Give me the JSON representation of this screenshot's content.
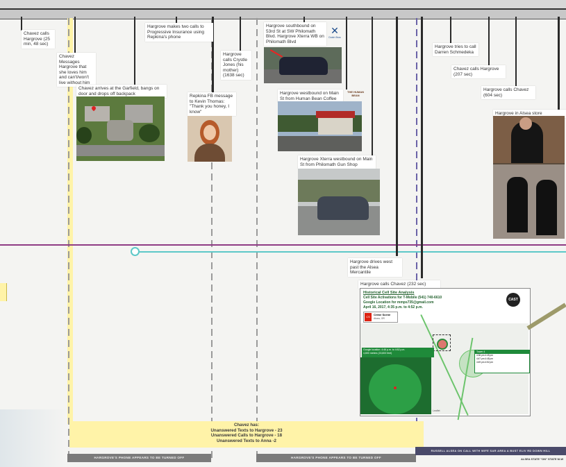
{
  "events": {
    "e1": "Chavez calls Hargrove (25 min, 48 sec)",
    "e2": "Chavez Messages Hargrove that she loves him and can't/won't live without him",
    "e3": "Chavez arrives at the Garfield, bangs on door and drops off backpack",
    "e4": "Hargrove makes two calls to Progressive Insurance using Repkina's phone",
    "e5": "Repkina FB message to Kevin Thomas: \"Thank you honey, I know\"",
    "e6": "Hargrove calls Crystle Jones (his mother) (1638 sec)",
    "e7": "Hargrove southbound on 53rd St at SW Philomath Blvd. Hargrove Xterra WB on Philomath Blvd",
    "e8": "Hargrove westbound on Main St from Human Bean Coffee",
    "e9": "Hargrove Xterra westbound on Main St from Philomath Gun Shop",
    "e10": "Hargrove drives west past the Alsea Mercantile",
    "e11": "Hargrove calls Chavez (232 sec)",
    "e12": "Hargrove tries to call Darren Schmedeka",
    "e13": "Chavez calls Hargrove (207 sec)",
    "e14": "Hargrove calls Chavez (604 sec)",
    "e15": "Hargrove in Alsea store"
  },
  "brand": {
    "dutch_bros": "Dutch Bros",
    "human_bean": "THE HUMAN BEAN"
  },
  "cell_analysis": {
    "title": "Historical Cell Site Analysis",
    "line1": "Cell Site Activations for T-Mobile (541) 740-6610",
    "line2": "Google Location for mmps735@gmail.com",
    "line3": "April 16, 2017, 4:35 p.m. to 4:52 p.m.",
    "logo": "CAST",
    "crime_scene_num": "CS",
    "crime_scene_label": "Crime Scene",
    "crime_scene_sub": "Alsea, OR",
    "google_box_l1": "Google location: 4:46 p.m. to 4:52 p.m.",
    "google_box_l2": "4,800 meters (15,800 feet)",
    "tower_label": "Tower 4",
    "tower_table": [
      "4:36 pm  4:45 pm",
      "4:47 pm  4:48 pm",
      "4:49 pm  4:52 pm"
    ],
    "map_credit": "Leaflet"
  },
  "summary": {
    "heading": "Chavez has:",
    "line1": "Unanswered Texts to Hargrove - 23",
    "line2": "Unanswered Calls to Hargrove - 18",
    "line3": "Unanswered Texts to Anna -2"
  },
  "status_bars": {
    "phone_off_1": "HARGROVE'S PHONE APPEARS TO BE TURNED OFF",
    "phone_off_2": "HARGROVE'S PHONE APPEARS TO BE TURNED OFF",
    "right_bar": "RUSSELL ALSEA ON CALL WITH WIFE SAR AREA A BUST ELIV RD DOWN HILL",
    "right_bar_sub": "ALSEA STATE \"ON\" STATE M-W"
  },
  "colors": {
    "purple_line": "#8e3b84",
    "teal_line": "#5cc8c8",
    "yellow_band": "#fff3a8",
    "dark_bar": "#4a4a6a",
    "gray_bar": "#7b7b7b",
    "green_panel": "#1f8a3a"
  }
}
